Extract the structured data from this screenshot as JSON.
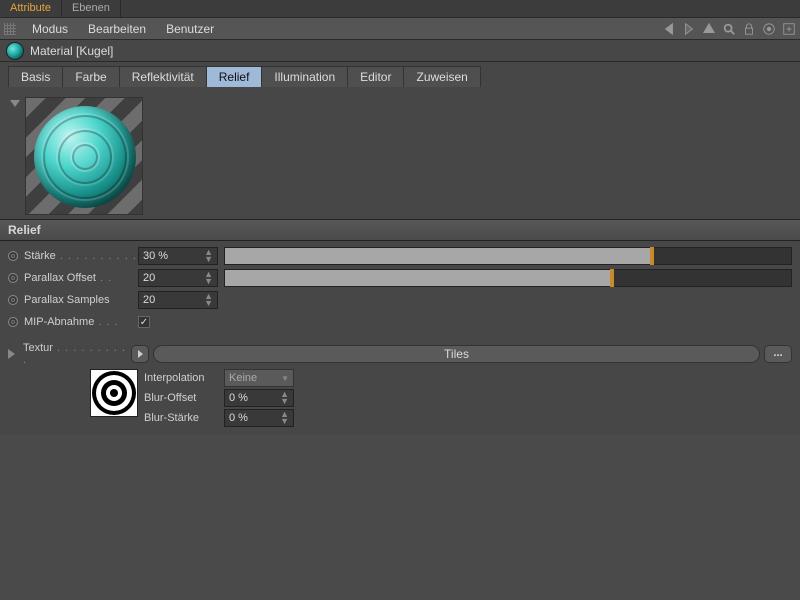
{
  "top_tabs": {
    "attribute": "Attribute",
    "ebenen": "Ebenen"
  },
  "toolbar": {
    "menu_modus": "Modus",
    "menu_bearbeiten": "Bearbeiten",
    "menu_benutzer": "Benutzer"
  },
  "material": {
    "title": "Material [Kugel]"
  },
  "channel_tabs": {
    "basis": "Basis",
    "farbe": "Farbe",
    "reflekt": "Reflektivität",
    "relief": "Relief",
    "illum": "Illumination",
    "editor": "Editor",
    "zuweisen": "Zuweisen"
  },
  "section": {
    "relief": "Relief"
  },
  "params": {
    "staerke_label": "Stärke",
    "staerke_value": "30 %",
    "staerke_fill_pct": 75,
    "parallax_offset_label": "Parallax Offset",
    "parallax_offset_value": "20",
    "parallax_offset_fill_pct": 68,
    "parallax_samples_label": "Parallax Samples",
    "parallax_samples_value": "20",
    "mip_label": "MIP-Abnahme",
    "mip_checked": "✓"
  },
  "textur": {
    "label": "Textur",
    "name": "Tiles",
    "dots": "...",
    "interpolation_label": "Interpolation",
    "interpolation_value": "Keine",
    "blur_offset_label": "Blur-Offset",
    "blur_offset_value": "0 %",
    "blur_staerke_label": "Blur-Stärke",
    "blur_staerke_value": "0 %"
  },
  "chart_data": {
    "type": "table",
    "title": "Relief channel parameters",
    "rows": [
      {
        "name": "Stärke",
        "value": "30 %"
      },
      {
        "name": "Parallax Offset",
        "value": 20
      },
      {
        "name": "Parallax Samples",
        "value": 20
      },
      {
        "name": "MIP-Abnahme",
        "value": true
      },
      {
        "name": "Textur",
        "value": "Tiles"
      },
      {
        "name": "Interpolation",
        "value": "Keine"
      },
      {
        "name": "Blur-Offset",
        "value": "0 %"
      },
      {
        "name": "Blur-Stärke",
        "value": "0 %"
      }
    ]
  }
}
